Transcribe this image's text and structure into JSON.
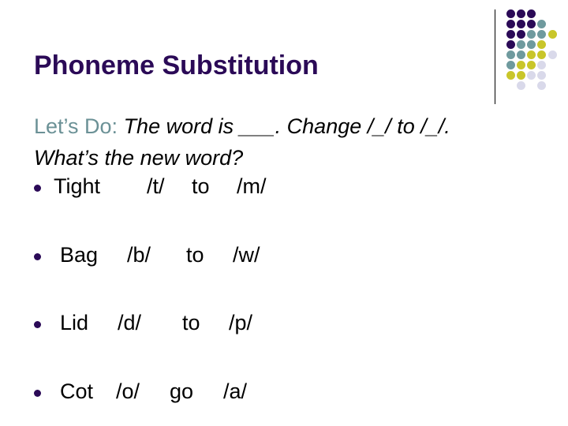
{
  "slide": {
    "title": "Phoneme Substitution",
    "intro": {
      "lead": "Let’s Do:",
      "line1_rest": " The word is ___.  Change /_/ to /_/.",
      "line2": "What’s the new word?"
    },
    "items": [
      {
        "word": "Tight",
        "from": "/t/",
        "connector": "to",
        "to": "/m/"
      },
      {
        "word": "Bag",
        "from": "/b/",
        "connector": "to",
        "to": "/w/"
      },
      {
        "word": "Lid",
        "from": "/d/",
        "connector": "to",
        "to": "/p/"
      },
      {
        "word": "Cot",
        "from": "/o/",
        "connector": "go",
        "to": "/a/"
      }
    ]
  },
  "colors": {
    "purple": "#2b0a57",
    "teal": "#6f9a9e",
    "yellow": "#c9c62a",
    "lavender": "#d9d9ea",
    "lead_text": "#6b9196"
  },
  "decoration": {
    "dot_grid": [
      [
        "P",
        "P",
        "P",
        "",
        ""
      ],
      [
        "P",
        "P",
        "P",
        "T",
        ""
      ],
      [
        "P",
        "P",
        "T",
        "T",
        "Y"
      ],
      [
        "P",
        "T",
        "T",
        "Y",
        ""
      ],
      [
        "T",
        "T",
        "Y",
        "Y",
        "L"
      ],
      [
        "T",
        "Y",
        "Y",
        "L",
        ""
      ],
      [
        "Y",
        "Y",
        "L",
        "L",
        ""
      ],
      [
        "",
        "L",
        "",
        "L",
        ""
      ]
    ]
  }
}
